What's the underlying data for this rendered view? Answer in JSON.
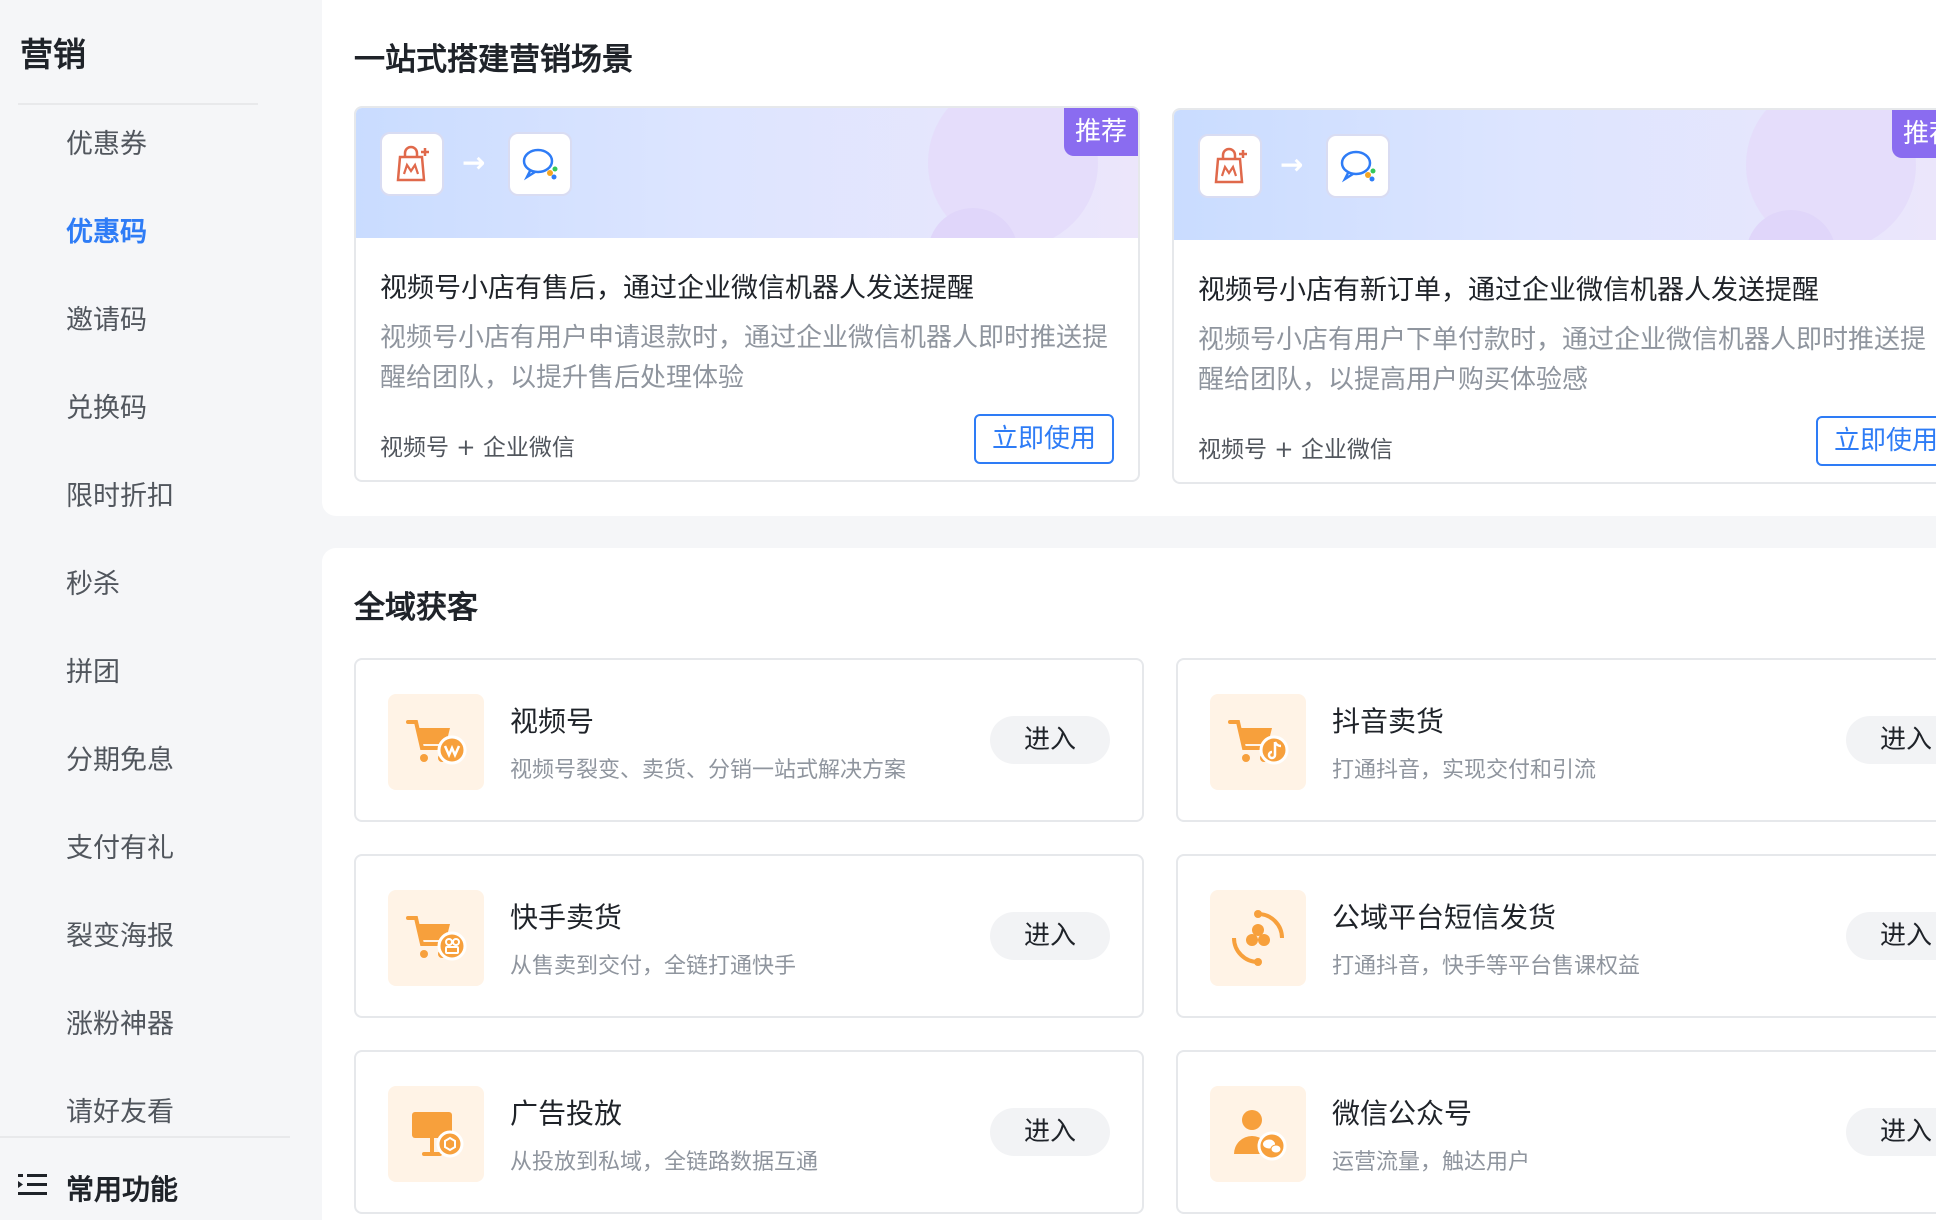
{
  "sidebar": {
    "title": "营销",
    "items": [
      {
        "label": "优惠券",
        "active": false
      },
      {
        "label": "优惠码",
        "active": true
      },
      {
        "label": "邀请码",
        "active": false
      },
      {
        "label": "兑换码",
        "active": false
      },
      {
        "label": "限时折扣",
        "active": false
      },
      {
        "label": "秒杀",
        "active": false
      },
      {
        "label": "拼团",
        "active": false
      },
      {
        "label": "分期免息",
        "active": false
      },
      {
        "label": "支付有礼",
        "active": false
      },
      {
        "label": "裂变海报",
        "active": false
      },
      {
        "label": "涨粉神器",
        "active": false
      },
      {
        "label": "请好友看",
        "active": false
      }
    ],
    "common_label": "常用功能",
    "common_icon": "list-icon",
    "active_color": "#2e7cf6"
  },
  "scenes": {
    "title": "一站式搭建营销场景",
    "cards": [
      {
        "tag": "推荐",
        "title": "视频号小店有售后，通过企业微信机器人发送提醒",
        "desc": "视频号小店有用户申请退款时，通过企业微信机器人即时推送提醒给团队，以提升售后处理体验",
        "platform": "视频号 + 企业微信",
        "button": "立即使用",
        "icons": [
          "shop-bag-icon",
          "arrow-right-icon",
          "chat-bot-icon"
        ]
      },
      {
        "tag": "推荐",
        "title": "视频号小店有新订单，通过企业微信机器人发送提醒",
        "desc": "视频号小店有用户下单付款时，通过企业微信机器人即时推送提醒给团队，以提高用户购买体验感",
        "platform": "视频号 + 企业微信",
        "button": "立即使用",
        "icons": [
          "shop-bag-icon",
          "arrow-right-icon",
          "chat-bot-icon"
        ]
      }
    ],
    "tag_color": "#8a6cf0"
  },
  "acquisition": {
    "title": "全域获客",
    "enter_label": "进入",
    "accent_color": "#f7a03c",
    "items": [
      {
        "name": "视频号",
        "desc": "视频号裂变、卖货、分销一站式解决方案",
        "icon": "cart-channels-icon"
      },
      {
        "name": "抖音卖货",
        "desc": "打通抖音，实现交付和引流",
        "icon": "cart-douyin-icon"
      },
      {
        "name": "快手卖货",
        "desc": "从售卖到交付，全链打通快手",
        "icon": "cart-kuaishou-icon"
      },
      {
        "name": "公域平台短信发货",
        "desc": "打通抖音，快手等平台售课权益",
        "icon": "sms-delivery-icon"
      },
      {
        "name": "广告投放",
        "desc": "从投放到私域，全链路数据互通",
        "icon": "ad-screen-icon"
      },
      {
        "name": "微信公众号",
        "desc": "运营流量，触达用户",
        "icon": "wechat-official-icon"
      }
    ]
  }
}
